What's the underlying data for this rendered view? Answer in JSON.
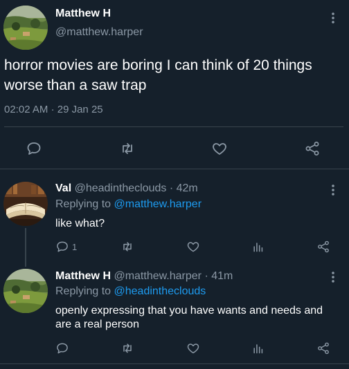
{
  "main_tweet": {
    "author_name": "Matthew H",
    "handle": "@matthew.harper",
    "text": "horror movies are boring I can think of 20 things worse than a saw trap",
    "time": "02:02 AM",
    "separator": "·",
    "date": "29 Jan 25",
    "actions": [
      "reply-icon",
      "retweet-icon",
      "like-icon",
      "share-icon"
    ]
  },
  "replies": [
    {
      "author_name": "Val",
      "handle": "@headintheclouds",
      "separator": "·",
      "time": "42m",
      "replying_label": "Replying to",
      "replying_to": "@matthew.harper",
      "text": "like what?",
      "reply_count": "1"
    },
    {
      "author_name": "Matthew H",
      "handle": "@matthew.harper",
      "separator": "·",
      "time": "41m",
      "replying_label": "Replying to",
      "replying_to": "@headintheclouds",
      "text": "openly expressing that you have wants and needs and are a real person",
      "reply_count": ""
    }
  ],
  "colors": {
    "background": "#15202b",
    "text": "#ffffff",
    "secondary": "#8b98a5",
    "link": "#1d9bf0",
    "divider": "#38444d"
  }
}
